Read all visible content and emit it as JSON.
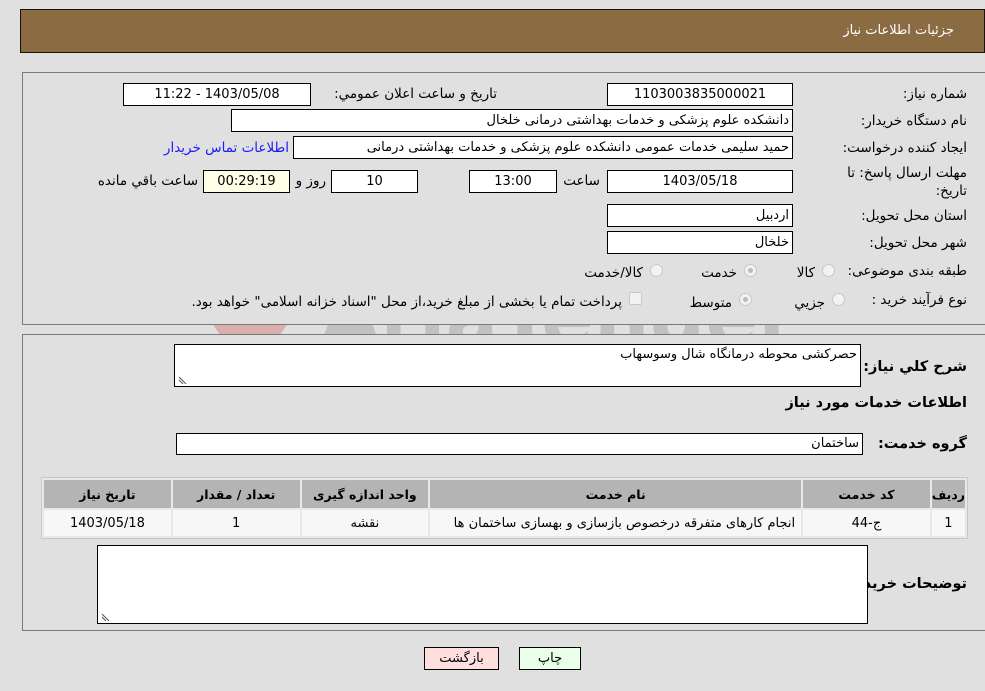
{
  "header": {
    "title": "جزئیات اطلاعات نیاز"
  },
  "details": {
    "need_number": {
      "label": "شماره نیاز:",
      "value": "1103003835000021"
    },
    "announce_datetime": {
      "label": "تاريخ و ساعت اعلان عمومي:",
      "value": "1403/05/08 - 11:22"
    },
    "buyer_org": {
      "label": "نام دستگاه خریدار:",
      "value": "دانشکده علوم پزشکی و خدمات بهداشتی درمانی خلخال"
    },
    "requester": {
      "label": "ایجاد کننده درخواست:",
      "value": "حمید سلیمی خدمات عمومی دانشکده علوم پزشکی و خدمات بهداشتی درمانی",
      "contact_link": "اطلاعات تماس خریدار"
    },
    "deadline": {
      "label": "مهلت ارسال پاسخ: تا تاریخ:",
      "date": "1403/05/18",
      "time_label": "ساعت",
      "time": "13:00",
      "days": "10",
      "days_label": "روز و",
      "remaining": "00:29:19",
      "remaining_label": "ساعت باقي مانده"
    },
    "province": {
      "label": "استان محل تحویل:",
      "value": "اردبیل"
    },
    "city": {
      "label": "شهر محل تحویل:",
      "value": "خلخال"
    },
    "category": {
      "label": "طبقه بندی موضوعی:",
      "options": [
        "کالا",
        "خدمت",
        "کالا/خدمت"
      ],
      "selected": "خدمت"
    },
    "purchase_process": {
      "label": "نوع فرآیند خرید :",
      "options": [
        "جزیي",
        "متوسط"
      ],
      "selected": "متوسط",
      "treasury_note": "پرداخت تمام یا بخشی از مبلغ خرید،از محل \"اسناد خزانه اسلامی\" خواهد بود."
    }
  },
  "summary": {
    "description_label": "شرح کلي نياز:",
    "description": "حصرکشی محوطه درمانگاه شال وسوسهاب",
    "services_heading": "اطلاعات خدمات مورد نیاز",
    "service_group_label": "گروه خدمت:",
    "service_group": "ساختمان",
    "table": {
      "headers": [
        "ردیف",
        "کد خدمت",
        "نام خدمت",
        "واحد اندازه گیری",
        "تعداد / مقدار",
        "تاریخ نیاز"
      ],
      "rows": [
        [
          "1",
          "ج-44",
          "انجام کارهای متفرقه درخصوص بازسازی و بهسازی ساختمان ها",
          "نقشه",
          "1",
          "1403/05/18"
        ]
      ]
    },
    "buyer_notes_label": "توضیحات خریدار:",
    "buyer_notes": ""
  },
  "buttons": {
    "print": "چاپ",
    "back": "بازگشت"
  },
  "watermark": {
    "text": "AriaTender.neT"
  },
  "colors": {
    "header": "#8b6b42",
    "link": "#1a1aff",
    "back_button": "#ffdede",
    "print_button": "#eaffea"
  }
}
